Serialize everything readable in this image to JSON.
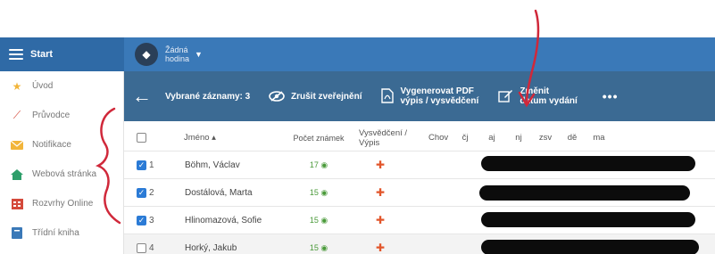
{
  "topbar": {
    "start_label": "Start",
    "hour_line1": "Žádná",
    "hour_line2": "hodina"
  },
  "sidebar": {
    "items": [
      {
        "label": "Úvod",
        "icon": "star-icon",
        "color": "#f2b53a"
      },
      {
        "label": "Průvodce",
        "icon": "wand-icon",
        "color": "#d4493b"
      },
      {
        "label": "Notifikace",
        "icon": "envelope-icon",
        "color": "#f2b53a"
      },
      {
        "label": "Webová stránka",
        "icon": "home-icon",
        "color": "#2e9e6a"
      },
      {
        "label": "Rozvrhy Online",
        "icon": "timetable-icon",
        "color": "#d4493b"
      },
      {
        "label": "Třídní kniha",
        "icon": "book-icon",
        "color": "#3a79b8"
      }
    ]
  },
  "actionbar": {
    "selected": "Vybrané záznamy: 3",
    "hide_publish": "Zrušit zveřejnění",
    "generate_pdf_1": "Vygenerovat PDF",
    "generate_pdf_2": "výpis / vysvědčení",
    "change_date_1": "Změnit",
    "change_date_2": "datum vydání",
    "more": "•••"
  },
  "table": {
    "headers": {
      "name": "Jméno ▴",
      "count": "Počet známek",
      "cert": "Vysvědčení / Výpis",
      "subjects": [
        "Chov",
        "čj",
        "aj",
        "nj",
        "zsv",
        "dě",
        "ma"
      ]
    },
    "rows": [
      {
        "idx": "1",
        "name": "Böhm, Václav",
        "count": "17",
        "checked": true
      },
      {
        "idx": "2",
        "name": "Dostálová, Marta",
        "count": "15",
        "checked": true
      },
      {
        "idx": "3",
        "name": "Hlinomazová, Sofie",
        "count": "15",
        "checked": true
      },
      {
        "idx": "4",
        "name": "Horký, Jakub",
        "count": "15",
        "checked": false
      }
    ]
  },
  "colors": {
    "topbar": "#3a79b8",
    "actionbar": "#3b6a93",
    "annotation": "#d0283a"
  }
}
